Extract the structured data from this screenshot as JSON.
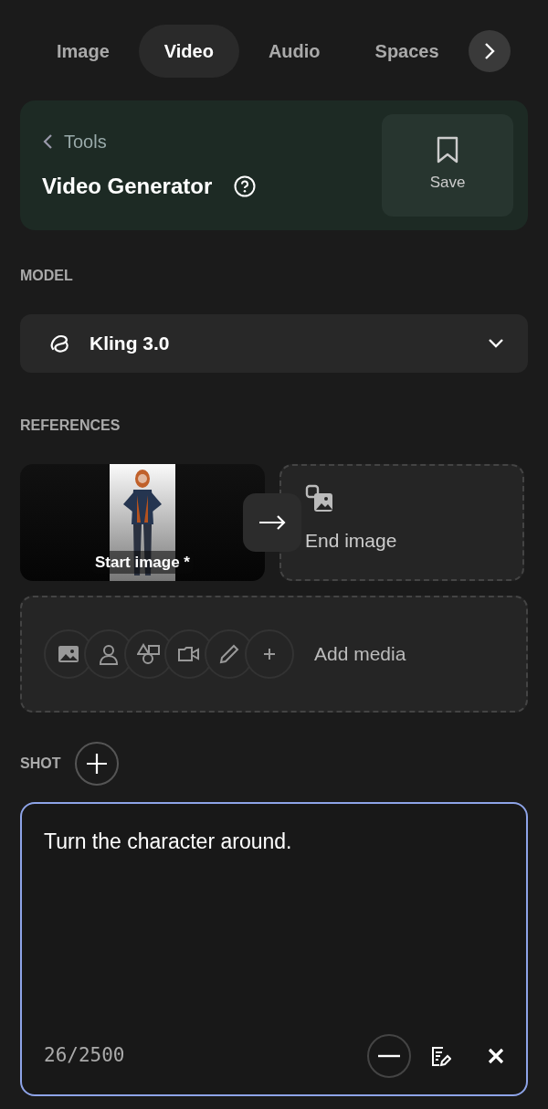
{
  "tabs": [
    {
      "label": "Image",
      "selected": false
    },
    {
      "label": "Video",
      "selected": true
    },
    {
      "label": "Audio",
      "selected": false
    },
    {
      "label": "Spaces",
      "selected": false
    }
  ],
  "header": {
    "back_label": "Tools",
    "title": "Video Generator",
    "save_label": "Save"
  },
  "model": {
    "section_label": "MODEL",
    "value": "Kling 3.0"
  },
  "references": {
    "section_label": "REFERENCES",
    "start_label": "Start image *",
    "end_label": "End image",
    "add_media_label": "Add media"
  },
  "shot": {
    "section_label": "SHOT",
    "prompt": "Turn the character around.",
    "counter": "26/2500"
  }
}
